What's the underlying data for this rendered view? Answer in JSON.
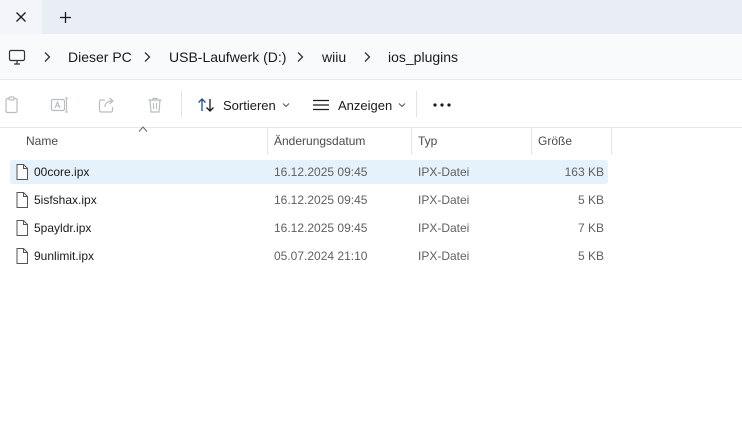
{
  "tabs": {
    "close_glyph": "✕",
    "new_tab_glyph": "+"
  },
  "breadcrumb": {
    "root_icon": "computer-icon",
    "items": [
      "Dieser PC",
      "USB-Laufwerk (D:)",
      "wiiu",
      "ios_plugins"
    ]
  },
  "commandbar": {
    "icons": [
      "paste-icon",
      "rename-icon",
      "share-icon",
      "delete-icon"
    ],
    "sort_label": "Sortieren",
    "view_label": "Anzeigen",
    "more_icon": "more-icon"
  },
  "columns": {
    "name": "Name",
    "modified": "Änderungsdatum",
    "type": "Typ",
    "size": "Größe"
  },
  "files": [
    {
      "name": "00core.ipx",
      "modified": "16.12.2025 09:45",
      "type": "IPX-Datei",
      "size": "163 KB",
      "selected": true
    },
    {
      "name": "5isfshax.ipx",
      "modified": "16.12.2025 09:45",
      "type": "IPX-Datei",
      "size": "5 KB",
      "selected": false
    },
    {
      "name": "5payldr.ipx",
      "modified": "16.12.2025 09:45",
      "type": "IPX-Datei",
      "size": "7 KB",
      "selected": false
    },
    {
      "name": "9unlimit.ipx",
      "modified": "05.07.2024 21:10",
      "type": "IPX-Datei",
      "size": "5 KB",
      "selected": false
    }
  ],
  "colors": {
    "selection": "#e5f1fb",
    "tabstrip": "#e9eef6"
  }
}
